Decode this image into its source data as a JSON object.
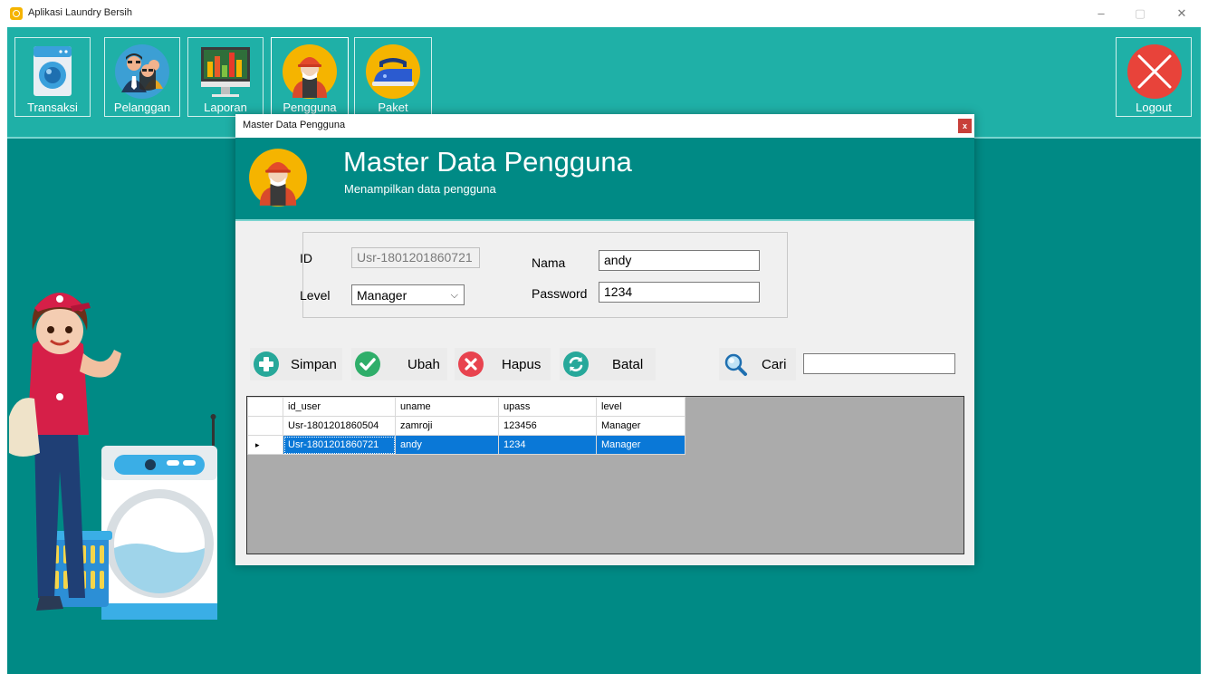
{
  "window": {
    "title": "Aplikasi Laundry Bersih",
    "minimize": "–",
    "maximize": "▢",
    "close": "✕"
  },
  "nav": [
    {
      "label": "Transaksi",
      "icon": "washing-machine-icon"
    },
    {
      "label": "Pelanggan",
      "icon": "customers-icon"
    },
    {
      "label": "Laporan",
      "icon": "report-chart-icon"
    },
    {
      "label": "Pengguna",
      "icon": "worker-user-icon"
    },
    {
      "label": "Paket",
      "icon": "iron-icon"
    }
  ],
  "logout": {
    "label": "Logout",
    "icon": "close-circle-icon"
  },
  "dialog": {
    "window_title": "Master Data Pengguna",
    "close": "x",
    "heading": "Master Data Pengguna",
    "subheading": "Menampilkan data pengguna"
  },
  "form": {
    "id_label": "ID",
    "id_value": "Usr-1801201860721",
    "nama_label": "Nama",
    "nama_value": "andy",
    "level_label": "Level",
    "level_value": "Manager",
    "password_label": "Password",
    "password_value": "1234"
  },
  "actions": {
    "simpan": "Simpan",
    "ubah": "Ubah",
    "hapus": "Hapus",
    "batal": "Batal",
    "cari": "Cari"
  },
  "search": {
    "value": ""
  },
  "grid": {
    "headers": [
      "id_user",
      "uname",
      "upass",
      "level"
    ],
    "rows": [
      [
        "Usr-1801201860504",
        "zamroji",
        "123456",
        "Manager"
      ],
      [
        "Usr-1801201860721",
        "andy",
        "1234",
        "Manager"
      ]
    ],
    "selected_row": 1,
    "current_row_marker": "▸"
  },
  "colors": {
    "teal_dark": "#008a85",
    "teal_light": "#1fb0a7",
    "selection": "#0a78d7"
  }
}
